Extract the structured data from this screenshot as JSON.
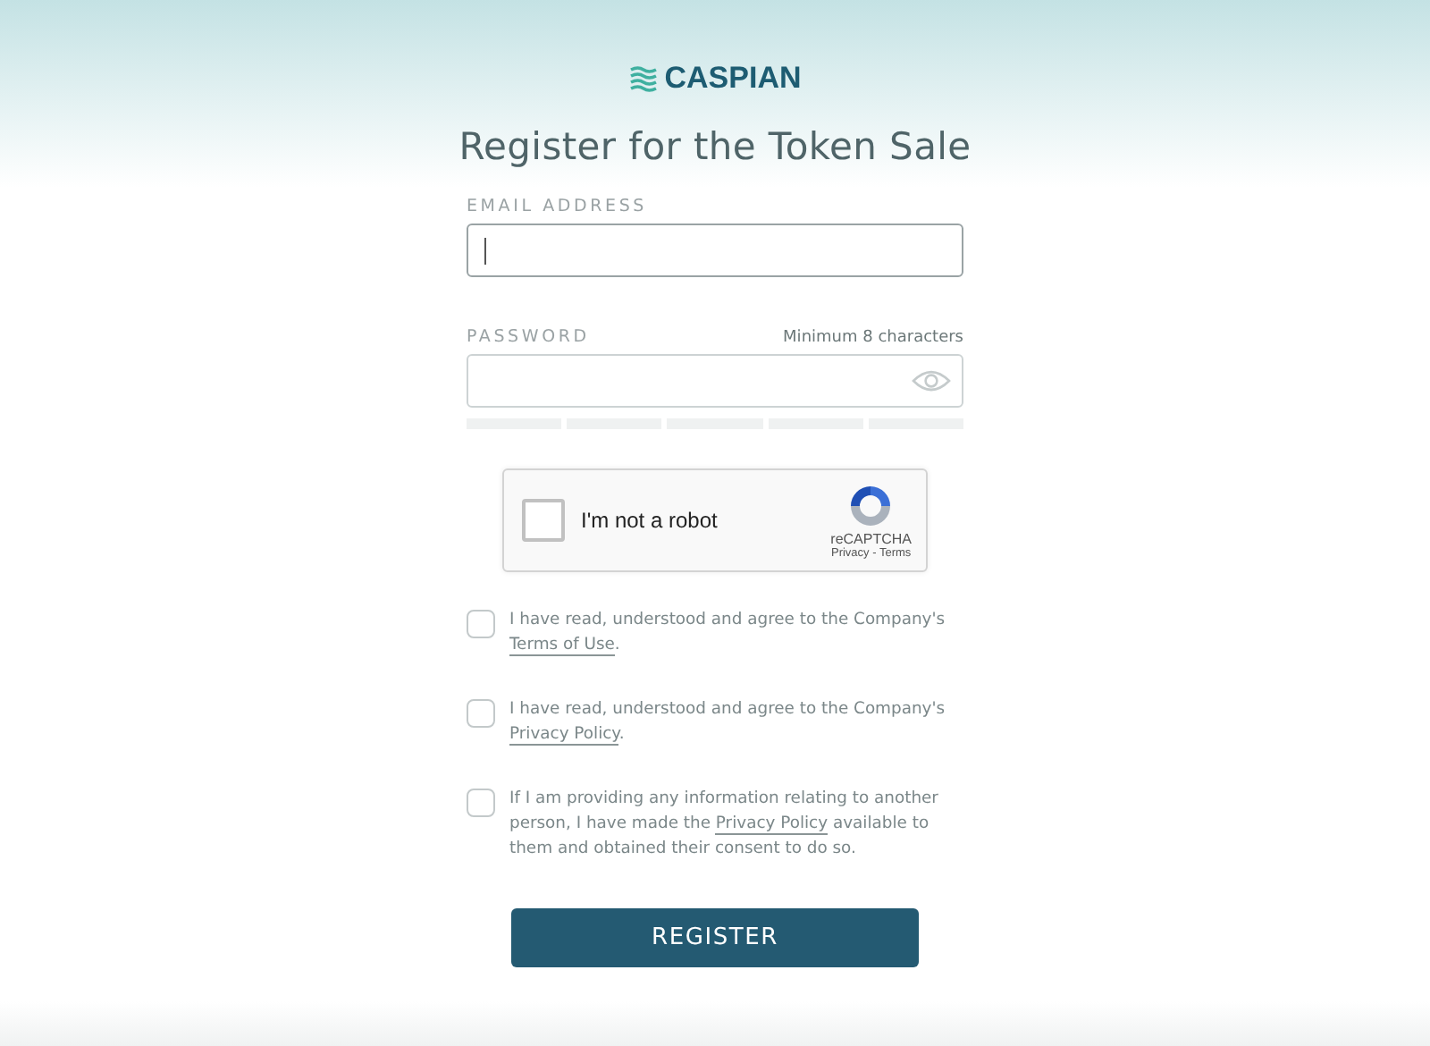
{
  "brand": {
    "name": "CASPIAN"
  },
  "title": "Register for the Token Sale",
  "email": {
    "label": "EMAIL ADDRESS",
    "focused": true
  },
  "password": {
    "label": "PASSWORD",
    "hint": "Minimum 8 characters",
    "strength": {
      "level": 0
    }
  },
  "captcha": {
    "label": "I'm not a robot",
    "checked": false,
    "brand": "reCAPTCHA",
    "links": "Privacy - Terms"
  },
  "agreements": [
    {
      "before": "I have read, understood and agree to the Company's ",
      "link": "Terms of Use",
      "after": ".",
      "checked": false
    },
    {
      "before": "I have read, understood and agree to the Company's ",
      "link": "Privacy Policy",
      "after": ".",
      "checked": false
    },
    {
      "before": "If I am providing any information relating to another person, I have made the ",
      "link": "Privacy Policy",
      "after": " available to them and obtained their consent to do so.",
      "checked": false
    }
  ],
  "submit": "REGISTER"
}
